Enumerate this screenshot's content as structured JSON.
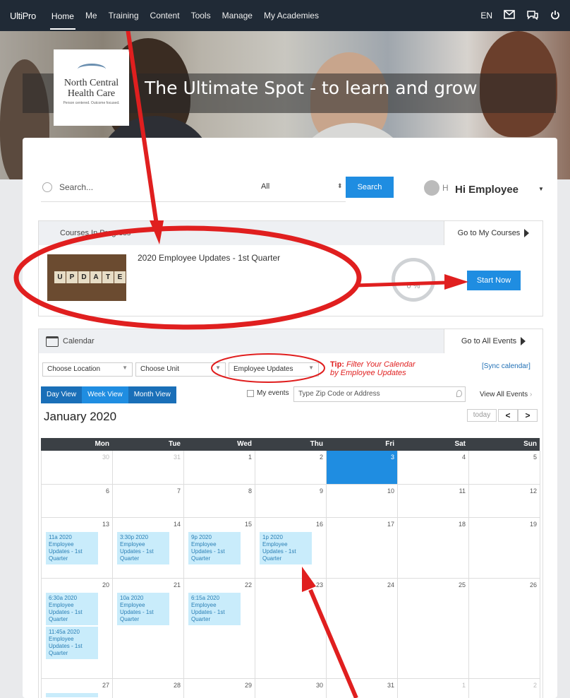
{
  "topnav": {
    "logo": "UltiPro",
    "items": [
      {
        "label": "Home",
        "active": true
      },
      {
        "label": "Me"
      },
      {
        "label": "Training"
      },
      {
        "label": "Content"
      },
      {
        "label": "Tools"
      },
      {
        "label": "Manage"
      },
      {
        "label": "My Academies"
      }
    ],
    "lang": "EN"
  },
  "hero": {
    "title": "The Ultimate Spot - to learn and grow",
    "org_name_line1": "North Central",
    "org_name_line2": "Health Care",
    "org_tagline": "Person centered. Outcome focused."
  },
  "search": {
    "placeholder": "Search...",
    "scope": "All",
    "button": "Search"
  },
  "user": {
    "initial": "H",
    "greeting": "Hi Employee"
  },
  "courses": {
    "header": "Courses In Progress",
    "link": "Go to My Courses",
    "item_title": "2020 Employee Updates - 1st Quarter",
    "image_word": [
      "U",
      "P",
      "D",
      "A",
      "T",
      "E"
    ],
    "progress": "0 %",
    "start_button": "Start Now"
  },
  "calendar": {
    "header": "Calendar",
    "link": "Go to All Events",
    "filters": {
      "location": "Choose Location",
      "unit": "Choose Unit",
      "category": "Employee Updates"
    },
    "tip_label": "Tip:",
    "tip_text_1": "Filter Your Calendar",
    "tip_text_2": "by Employee Updates",
    "sync": "[Sync calendar]",
    "views": [
      "Day View",
      "Week View",
      "Month View"
    ],
    "my_events": "My events",
    "zip_placeholder": "Type Zip Code or Address",
    "view_all": "View All Events",
    "month_label": "January 2020",
    "today": "today",
    "prev": "<",
    "next": ">",
    "days_of_week": [
      "Mon",
      "Tue",
      "Wed",
      "Thu",
      "Fri",
      "Sat",
      "Sun"
    ],
    "weeks": [
      [
        {
          "n": "30",
          "dim": true
        },
        {
          "n": "31",
          "dim": true
        },
        {
          "n": "1"
        },
        {
          "n": "2"
        },
        {
          "n": "3",
          "today": true
        },
        {
          "n": "4"
        },
        {
          "n": "5"
        }
      ],
      [
        {
          "n": "6"
        },
        {
          "n": "7"
        },
        {
          "n": "8"
        },
        {
          "n": "9"
        },
        {
          "n": "10"
        },
        {
          "n": "11"
        },
        {
          "n": "12"
        }
      ],
      [
        {
          "n": "13",
          "events": [
            "11a 2020 Employee Updates - 1st Quarter"
          ]
        },
        {
          "n": "14",
          "events": [
            "3:30p 2020 Employee Updates - 1st Quarter"
          ]
        },
        {
          "n": "15",
          "events": [
            "9p 2020 Employee Updates - 1st Quarter"
          ]
        },
        {
          "n": "16",
          "events": [
            "1p 2020 Employee Updates - 1st Quarter"
          ]
        },
        {
          "n": "17"
        },
        {
          "n": "18"
        },
        {
          "n": "19"
        }
      ],
      [
        {
          "n": "20",
          "events": [
            "6:30a 2020 Employee Updates - 1st Quarter",
            "11:45a 2020 Employee Updates - 1st Quarter"
          ]
        },
        {
          "n": "21",
          "events": [
            "10a 2020 Employee Updates - 1st Quarter"
          ]
        },
        {
          "n": "22",
          "events": [
            "6:15a 2020 Employee Updates - 1st Quarter"
          ]
        },
        {
          "n": "23"
        },
        {
          "n": "24"
        },
        {
          "n": "25"
        },
        {
          "n": "26"
        }
      ],
      [
        {
          "n": "27",
          "events": [
            ""
          ]
        },
        {
          "n": "28"
        },
        {
          "n": "29"
        },
        {
          "n": "30"
        },
        {
          "n": "31"
        },
        {
          "n": "1",
          "dim": true
        },
        {
          "n": "2",
          "dim": true
        }
      ]
    ]
  },
  "colors": {
    "accent": "#1f8de1",
    "annotation": "#e01f1f",
    "nav": "#202a36"
  }
}
